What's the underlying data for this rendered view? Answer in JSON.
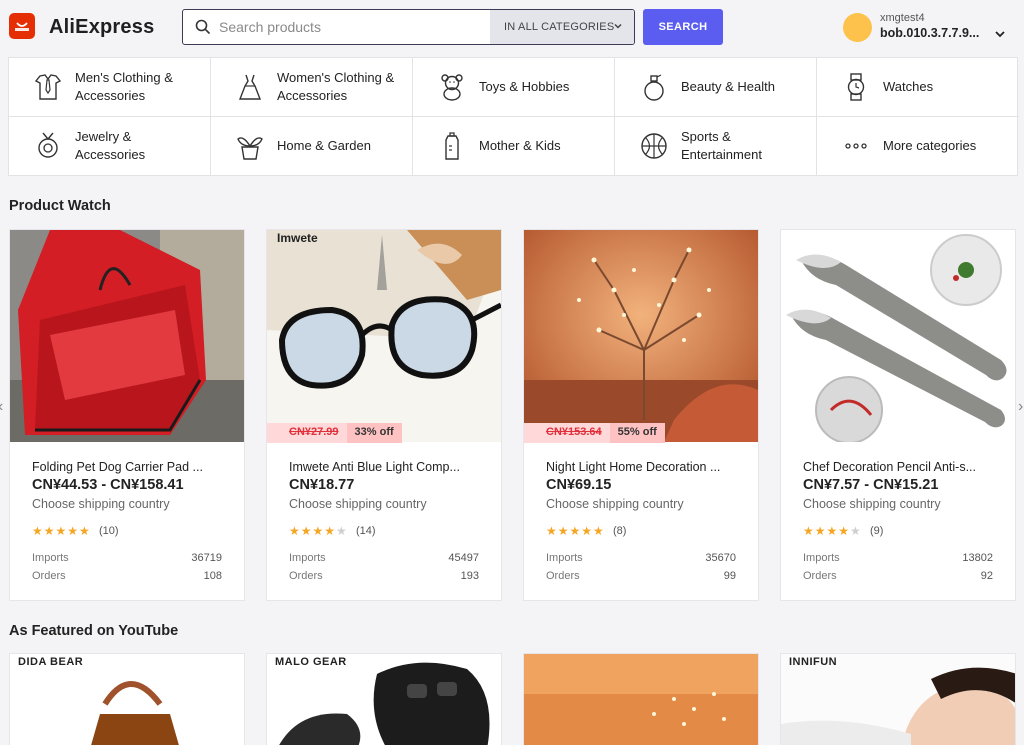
{
  "header": {
    "logo_text": "AliExpress",
    "search_placeholder": "Search products",
    "category_select": "IN ALL CATEGORIES",
    "search_button": "SEARCH",
    "user_name": "xmgtest4",
    "user_id": "bob.010.3.7.7.9...",
    "accent_color": "#5b5cf0"
  },
  "categories": [
    {
      "label": "Men's Clothing & Accessories",
      "icon": "shirt-tie-icon"
    },
    {
      "label": "Women's Clothing & Accessories",
      "icon": "dress-icon"
    },
    {
      "label": "Toys & Hobbies",
      "icon": "teddy-bear-icon"
    },
    {
      "label": "Beauty & Health",
      "icon": "perfume-icon"
    },
    {
      "label": "Watches",
      "icon": "watch-icon"
    },
    {
      "label": "Jewelry & Accessories",
      "icon": "ring-icon"
    },
    {
      "label": "Home & Garden",
      "icon": "plant-icon"
    },
    {
      "label": "Mother & Kids",
      "icon": "baby-bottle-icon"
    },
    {
      "label": "Sports & Entertainment",
      "icon": "basketball-icon"
    },
    {
      "label": "More categories",
      "icon": "more-dots-icon"
    }
  ],
  "product_watch": {
    "title": "Product Watch",
    "products": [
      {
        "name": "Folding Pet Dog Carrier Pad ...",
        "price": "CN¥44.53 - CN¥158.41",
        "shipping": "Choose shipping country",
        "rating": 5,
        "reviews": "(10)",
        "imports_label": "Imports",
        "imports": "36719",
        "orders_label": "Orders",
        "orders": "108",
        "old_price": "",
        "discount": ""
      },
      {
        "name": "Imwete Anti Blue Light Comp...",
        "price": "CN¥18.77",
        "shipping": "Choose shipping country",
        "rating": 4,
        "reviews": "(14)",
        "imports_label": "Imports",
        "imports": "45497",
        "orders_label": "Orders",
        "orders": "193",
        "old_price": "CN¥27.99",
        "discount": "33% off"
      },
      {
        "name": "Night Light Home Decoration ...",
        "price": "CN¥69.15",
        "shipping": "Choose shipping country",
        "rating": 5,
        "reviews": "(8)",
        "imports_label": "Imports",
        "imports": "35670",
        "orders_label": "Orders",
        "orders": "99",
        "old_price": "CN¥153.64",
        "discount": "55% off"
      },
      {
        "name": "Chef Decoration Pencil Anti-s...",
        "price": "CN¥7.57 - CN¥15.21",
        "shipping": "Choose shipping country",
        "rating": 4,
        "reviews": "(9)",
        "imports_label": "Imports",
        "imports": "13802",
        "orders_label": "Orders",
        "orders": "92",
        "old_price": "",
        "discount": ""
      }
    ]
  },
  "youtube": {
    "title": "As Featured on YouTube",
    "brands": [
      "DIDA BEAR",
      "MALO GEAR",
      "",
      "INNIFUN"
    ]
  }
}
